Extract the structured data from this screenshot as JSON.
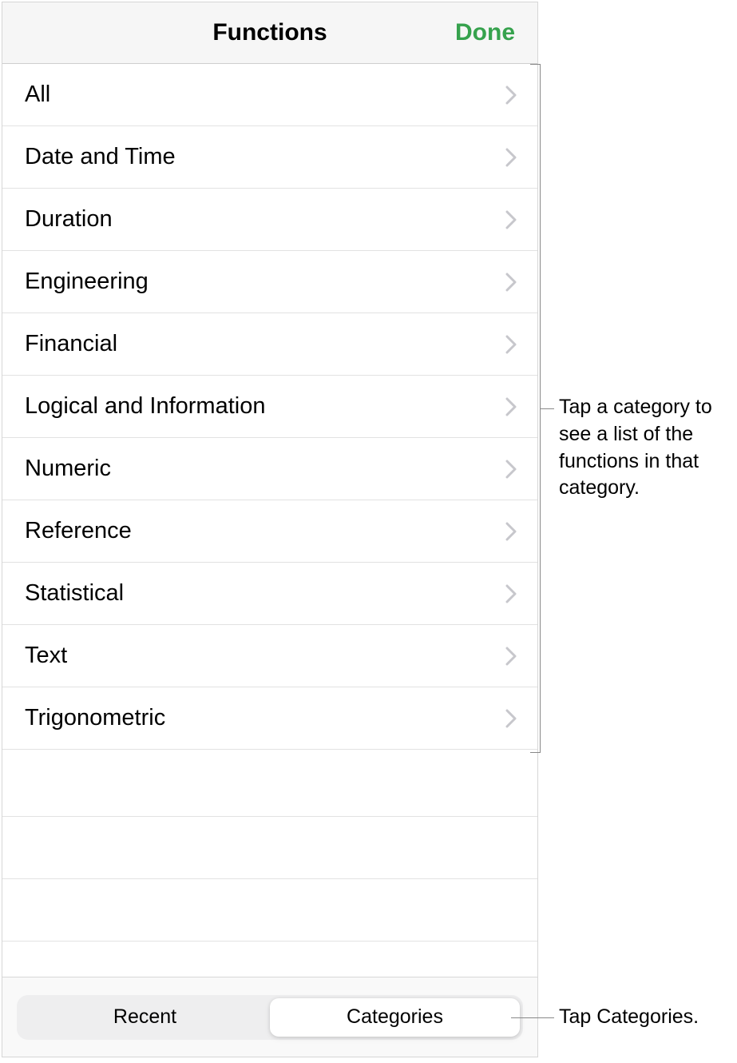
{
  "header": {
    "title": "Functions",
    "done_label": "Done"
  },
  "categories": [
    "All",
    "Date and Time",
    "Duration",
    "Engineering",
    "Financial",
    "Logical and Information",
    "Numeric",
    "Reference",
    "Statistical",
    "Text",
    "Trigonometric"
  ],
  "footer": {
    "tabs": {
      "recent": "Recent",
      "categories": "Categories"
    },
    "active": "categories"
  },
  "annotations": {
    "list_callout": "Tap a category to see a list of the functions in that category.",
    "footer_callout": "Tap Categories."
  }
}
